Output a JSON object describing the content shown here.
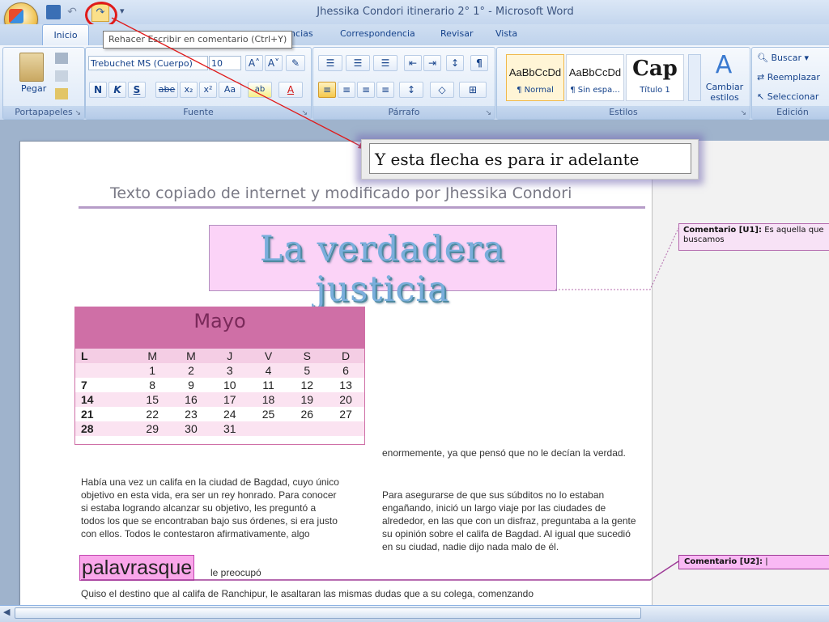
{
  "window": {
    "title": "Jhessika Condori itinerario 2° 1° - Microsoft Word"
  },
  "quick_access": {
    "undo_icon": "↶",
    "redo_icon": "↷",
    "more": "▾"
  },
  "tooltip": "Rehacer Escribir en comentario (Ctrl+Y)",
  "tabs": [
    {
      "label": "Inicio"
    },
    {
      "label": "rencias"
    },
    {
      "label": "Correspondencia"
    },
    {
      "label": "Revisar"
    },
    {
      "label": "Vista"
    }
  ],
  "ribbon": {
    "clipboard": {
      "paste": "Pegar",
      "label": "Portapapeles"
    },
    "font": {
      "font_name": "Trebuchet MS (Cuerpo)",
      "font_size": "10",
      "grow": "A˄",
      "shrink": "A˅",
      "bold": "N",
      "italic": "K",
      "underline": "S",
      "strike": "abe",
      "subscript": "x₂",
      "superscript": "x²",
      "case": "Aa",
      "highlight": "ab",
      "color": "A",
      "label": "Fuente"
    },
    "paragraph": {
      "pilcrow": "¶",
      "label": "Párrafo"
    },
    "styles": {
      "items": [
        {
          "sample": "AaBbCcDd",
          "name": "¶ Normal"
        },
        {
          "sample": "AaBbCcDd",
          "name": "¶ Sin espa..."
        },
        {
          "sample": "Cap",
          "name": "Título 1"
        }
      ],
      "change": "Cambiar estilos",
      "label": "Estilos"
    },
    "editing": {
      "find": "Buscar",
      "replace": "Reemplazar",
      "select": "Seleccionar",
      "label": "Edición"
    }
  },
  "callout": "Y esta flecha es para ir adelante",
  "document": {
    "header": "Texto copiado de internet y modificado por Jhessika Condori",
    "wordart": "La verdadera justicia",
    "calendar": {
      "month": "Mayo",
      "days": [
        "L",
        "M",
        "M",
        "J",
        "V",
        "S",
        "D"
      ],
      "weeks": [
        [
          "",
          "",
          "1",
          "2",
          "3",
          "4",
          "5",
          "6"
        ],
        [
          "7",
          "8",
          "9",
          "10",
          "11",
          "12",
          "13"
        ],
        [
          "14",
          "15",
          "16",
          "17",
          "18",
          "19",
          "20"
        ],
        [
          "21",
          "22",
          "23",
          "24",
          "25",
          "26",
          "27"
        ],
        [
          "28",
          "29",
          "30",
          "31",
          "",
          "",
          ""
        ]
      ]
    },
    "col1": "Había una vez un califa en la ciudad de Bagdad, cuyo único objetivo en esta vida, era ser un rey honrado. Para conocer si estaba logrando alcanzar su objetivo, les preguntó a todos los que se encontraban bajo sus órdenes, si era justo con ellos. Todos le contestaron afirmativamente, algo",
    "highlight_word": "palavrasque",
    "after_highlight": "le preocupó",
    "col2a": "enormemente, ya que pensó que no le decían la verdad.",
    "col2b": "Para asegurarse de que sus súbditos no lo estaban engañando, inició un largo viaje  por las ciudades de alrededor, en las que con un disfraz, preguntaba a la gente su opinión sobre el califa de Bagdad. Al igual que sucedió en su ciudad, nadie dijo nada malo de él.",
    "bottom": "Quiso el destino que al califa de Ranchipur,  le asaltaran  las mismas dudas que a su colega, comenzando"
  },
  "comments": [
    {
      "label": "Comentario [U1]:",
      "text": "Es aquella que buscamos"
    },
    {
      "label": "Comentario [U2]:",
      "text": "|"
    }
  ],
  "colors": {
    "accent": "#cf6fa6",
    "annotation_red": "#e01b1b"
  }
}
